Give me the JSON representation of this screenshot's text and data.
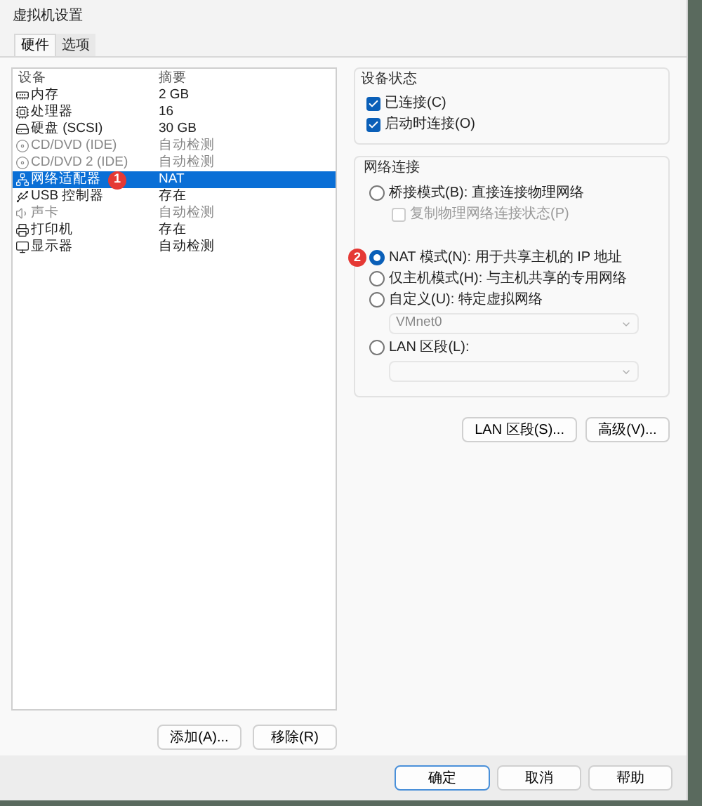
{
  "window": {
    "title": "虚拟机设置"
  },
  "tabs": [
    {
      "label": "硬件",
      "selected": true
    },
    {
      "label": "选项",
      "selected": false
    }
  ],
  "device_table": {
    "columns": [
      "设备",
      "摘要"
    ],
    "rows": [
      {
        "kind": "memory",
        "device": "内存",
        "summary": "2 GB",
        "selected": false,
        "disabled": false
      },
      {
        "kind": "cpu",
        "device": "处理器",
        "summary": "16",
        "selected": false,
        "disabled": false
      },
      {
        "kind": "disk",
        "device": "硬盘 (SCSI)",
        "summary": "30 GB",
        "selected": false,
        "disabled": false
      },
      {
        "kind": "cd",
        "device": "CD/DVD (IDE)",
        "summary": "自动检测",
        "selected": false,
        "disabled": true
      },
      {
        "kind": "cd",
        "device": "CD/DVD 2 (IDE)",
        "summary": "自动检测",
        "selected": false,
        "disabled": true
      },
      {
        "kind": "network",
        "device": "网络适配器",
        "summary": "NAT",
        "selected": true,
        "disabled": false,
        "badge": "1"
      },
      {
        "kind": "usb",
        "device": "USB 控制器",
        "summary": "存在",
        "selected": false,
        "disabled": false
      },
      {
        "kind": "sound",
        "device": "声卡",
        "summary": "自动检测",
        "selected": false,
        "disabled": true
      },
      {
        "kind": "printer",
        "device": "打印机",
        "summary": "存在",
        "selected": false,
        "disabled": false
      },
      {
        "kind": "display",
        "device": "显示器",
        "summary": "自动检测",
        "selected": false,
        "disabled": false
      }
    ]
  },
  "left_buttons": [
    "添加(A)...",
    "移除(R)"
  ],
  "device_status": {
    "title": "设备状态",
    "options": [
      {
        "label": "已连接(C)",
        "checked": true
      },
      {
        "label": "启动时连接(O)",
        "checked": true
      }
    ]
  },
  "network_connection": {
    "title": "网络连接",
    "options": [
      {
        "kind": "radio",
        "label": "桥接模式(B): 直接连接物理网络",
        "selected": false,
        "disabled": false
      },
      {
        "kind": "checkbox",
        "label": "复制物理网络连接状态(P)",
        "checked": false,
        "disabled": true
      },
      {
        "kind": "radio",
        "label": "NAT 模式(N): 用于共享主机的 IP 地址",
        "selected": true,
        "disabled": false,
        "badge": "2"
      },
      {
        "kind": "radio",
        "label": "仅主机模式(H): 与主机共享的专用网络",
        "selected": false,
        "disabled": false
      },
      {
        "kind": "radio",
        "label": "自定义(U): 特定虚拟网络",
        "selected": false,
        "disabled": false
      },
      {
        "kind": "select",
        "value": "VMnet0",
        "disabled": true
      },
      {
        "kind": "radio",
        "label": "LAN 区段(L):",
        "selected": false,
        "disabled": false
      },
      {
        "kind": "select",
        "disabled": true
      }
    ]
  },
  "right_buttons": [
    "LAN 区段(S)...",
    "高级(V)..."
  ],
  "footer_buttons": [
    {
      "label": "确定",
      "default": true
    },
    {
      "label": "取消",
      "default": false
    },
    {
      "label": "帮助",
      "default": false
    }
  ]
}
